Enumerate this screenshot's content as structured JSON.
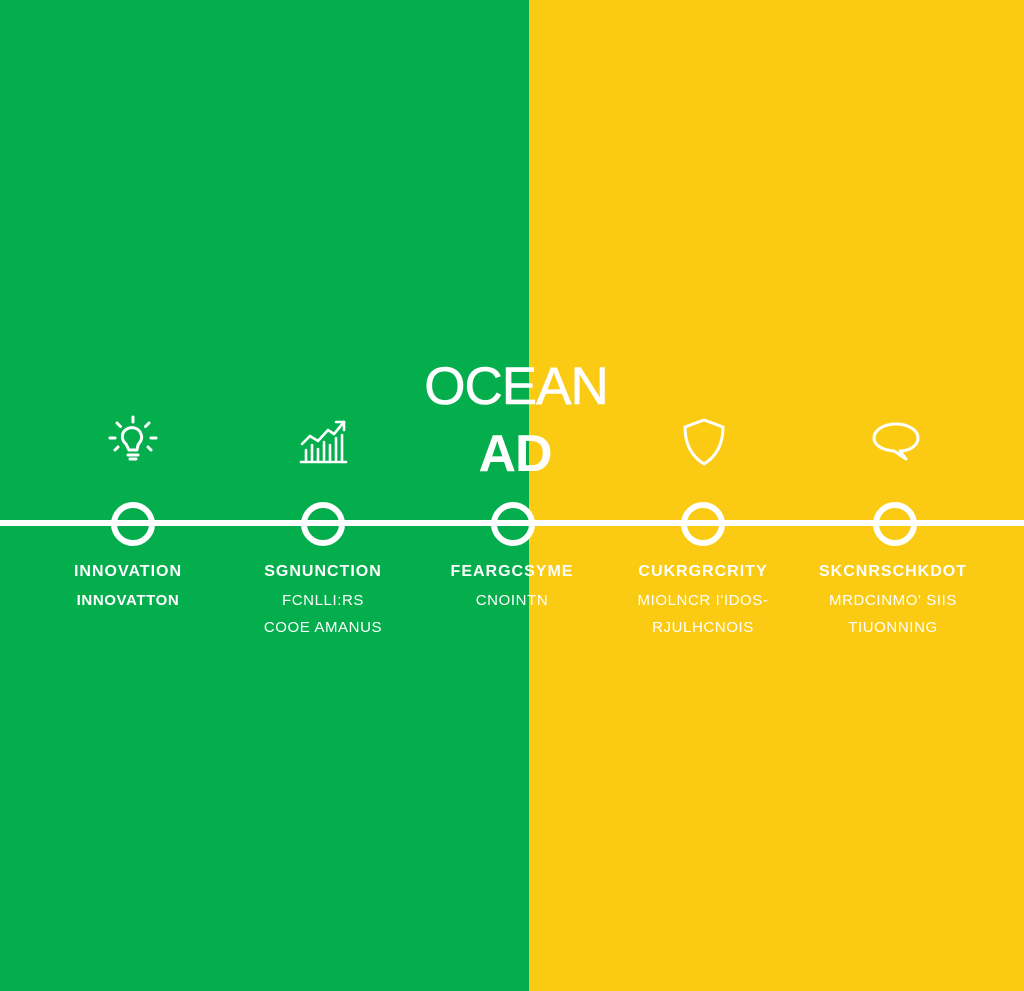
{
  "colors": {
    "left_panel": "#04AE4D",
    "right_panel": "#FBCA12",
    "foreground": "#FFFFFF"
  },
  "title": {
    "line1": "OCEAN",
    "line2": "AD"
  },
  "steps": [
    {
      "icon": "lightbulb-icon",
      "title": "INNOVATION",
      "lines": [
        "INNOVATTON",
        ""
      ]
    },
    {
      "icon": "growth-chart-icon",
      "title": "SGNUNCTION",
      "lines": [
        "FCNLLI:RS",
        "COOE AMANUS"
      ]
    },
    {
      "icon": "",
      "title": "FEARGCSYME",
      "lines": [
        "CNOINTN",
        ""
      ]
    },
    {
      "icon": "shield-icon",
      "title": "CUKRGRCRITY",
      "lines": [
        "MIOLNCR I'IDOS-",
        "RJULHCNOIS"
      ]
    },
    {
      "icon": "speech-bubble-icon",
      "title": "SKCNRSCHKDOT",
      "lines": [
        "MRDCINMO' SIIS",
        "TIUONNING"
      ]
    }
  ]
}
